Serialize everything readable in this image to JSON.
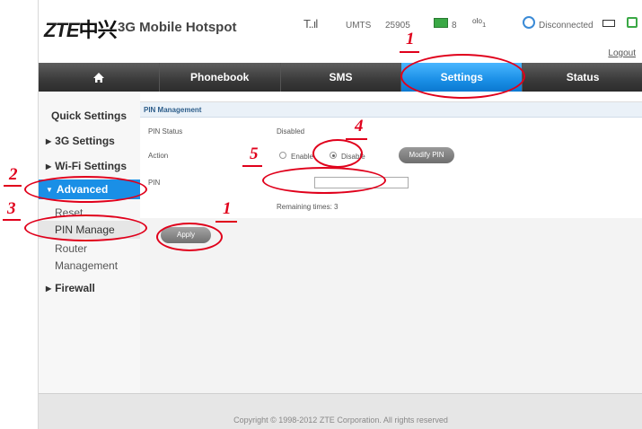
{
  "header": {
    "logo_brand": "ZTE",
    "logo_cn": "中兴",
    "product": "3G Mobile Hotspot",
    "signal": "T..ıl",
    "network": "UMTS",
    "operator": "25905",
    "sms_count": "8",
    "connection": "Disconnected",
    "logout": "Logout"
  },
  "nav": {
    "items": [
      {
        "label": "",
        "icon": "home-icon"
      },
      {
        "label": "Phonebook"
      },
      {
        "label": "SMS"
      },
      {
        "label": "Settings",
        "active": true
      },
      {
        "label": "Status"
      }
    ]
  },
  "sidebar": {
    "quick": "Quick Settings",
    "g3": "3G Settings",
    "wifi": "Wi-Fi Settings",
    "advanced": "Advanced",
    "sub": [
      "Reset",
      "PIN Manage",
      "Router",
      "Management"
    ],
    "firewall": "Firewall"
  },
  "panel": {
    "title": "PIN Management",
    "status_label": "PIN Status",
    "status_value": "Disabled",
    "action_label": "Action",
    "enable": "Enable",
    "disable": "Disable",
    "modify": "Modify PIN",
    "pin_label": "PIN",
    "remaining": "Remaining times: 3",
    "apply": "Apply"
  },
  "footer": {
    "copyright": "Copyright © 1998-2012 ZTE Corporation. All rights reserved"
  },
  "annotations": {
    "n1a": "1",
    "n1b": "1",
    "n2": "2",
    "n3": "3",
    "n4": "4",
    "n5": "5"
  },
  "colors": {
    "accent": "#1a8fe6",
    "annotation": "#e0001b"
  }
}
